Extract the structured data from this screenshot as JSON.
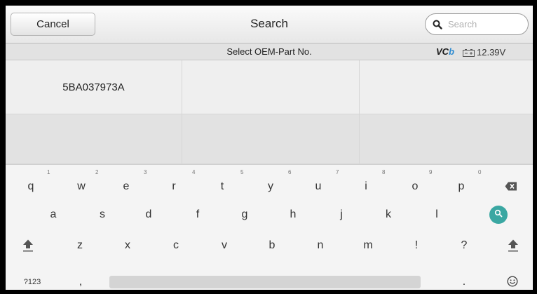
{
  "header": {
    "cancel_label": "Cancel",
    "title": "Search",
    "search_placeholder": "Search"
  },
  "subheader": {
    "title": "Select OEM-Part No.",
    "vci_prefix": "VC",
    "vci_suffix": "b",
    "battery_icon": "battery-icon",
    "voltage": "12.39V"
  },
  "grid": {
    "rows": [
      [
        "5BA037973A",
        "",
        ""
      ],
      [
        "",
        "",
        ""
      ]
    ]
  },
  "keyboard": {
    "row1": [
      "q",
      "w",
      "e",
      "r",
      "t",
      "y",
      "u",
      "i",
      "o",
      "p"
    ],
    "row1_hints": [
      "1",
      "2",
      "3",
      "4",
      "5",
      "6",
      "7",
      "8",
      "9",
      "0"
    ],
    "row2": [
      "a",
      "s",
      "d",
      "f",
      "g",
      "h",
      "j",
      "k",
      "l"
    ],
    "row3": [
      "z",
      "x",
      "c",
      "v",
      "b",
      "n",
      "m",
      "!",
      "?"
    ],
    "symbols_label": "?123",
    "comma_label": ",",
    "period_label": ".",
    "icons": [
      "backspace-icon",
      "search-go-icon",
      "shift-icon",
      "emoji-icon"
    ]
  }
}
